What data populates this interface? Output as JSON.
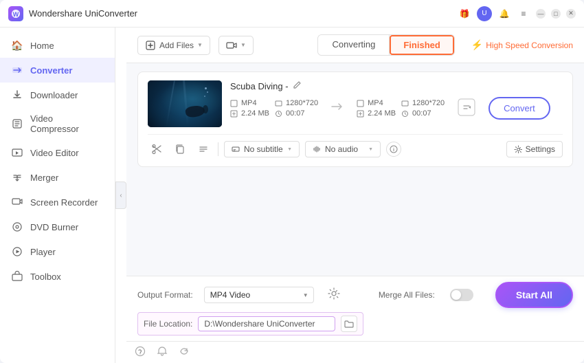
{
  "titleBar": {
    "appName": "Wondershare UniConverter",
    "logoText": "W"
  },
  "sidebar": {
    "items": [
      {
        "id": "home",
        "label": "Home",
        "icon": "🏠",
        "active": false
      },
      {
        "id": "converter",
        "label": "Converter",
        "icon": "⇄",
        "active": true
      },
      {
        "id": "downloader",
        "label": "Downloader",
        "icon": "⬇",
        "active": false
      },
      {
        "id": "video-compressor",
        "label": "Video Compressor",
        "icon": "⊞",
        "active": false
      },
      {
        "id": "video-editor",
        "label": "Video Editor",
        "icon": "✂",
        "active": false
      },
      {
        "id": "merger",
        "label": "Merger",
        "icon": "⊕",
        "active": false
      },
      {
        "id": "screen-recorder",
        "label": "Screen Recorder",
        "icon": "⊙",
        "active": false
      },
      {
        "id": "dvd-burner",
        "label": "DVD Burner",
        "icon": "💿",
        "active": false
      },
      {
        "id": "player",
        "label": "Player",
        "icon": "▶",
        "active": false
      },
      {
        "id": "toolbox",
        "label": "Toolbox",
        "icon": "⊞",
        "active": false
      }
    ]
  },
  "toolbar": {
    "addFiles": "Add Files",
    "addIcon": "+",
    "cameraIcon": "🎥",
    "tabs": [
      {
        "id": "converting",
        "label": "Converting",
        "active": false
      },
      {
        "id": "finished",
        "label": "Finished",
        "active": true
      }
    ],
    "highSpeed": "High Speed Conversion"
  },
  "fileItem": {
    "name": "Scuba Diving -",
    "editIcon": "✏",
    "source": {
      "format": "MP4",
      "resolution": "1280*720",
      "size": "2.24 MB",
      "duration": "00:07"
    },
    "target": {
      "format": "MP4",
      "resolution": "1280*720",
      "size": "2.24 MB",
      "duration": "00:07"
    },
    "convertBtn": "Convert",
    "subtitle": "No subtitle",
    "audio": "No audio",
    "settings": "Settings"
  },
  "bottomBar": {
    "outputFormatLabel": "Output Format:",
    "outputFormat": "MP4 Video",
    "mergeLabel": "Merge All Files:",
    "startAll": "Start All",
    "fileLocationLabel": "File Location:",
    "fileLocation": "D:\\Wondershare UniConverter"
  },
  "statusBar": {
    "icons": [
      "?",
      "🔔",
      "↺"
    ]
  }
}
